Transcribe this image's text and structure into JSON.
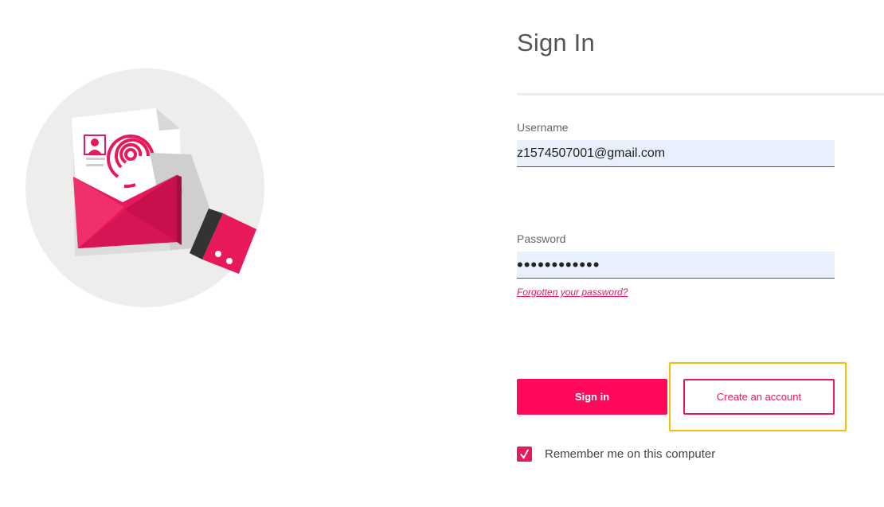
{
  "signin": {
    "title": "Sign In",
    "username": {
      "label": "Username",
      "value": "z1574507001@gmail.com"
    },
    "password": {
      "label": "Password",
      "value": "••••••••••••"
    },
    "forgot_link": "Forgotten your password?",
    "signin_button": "Sign in",
    "create_account_button": "Create an account",
    "remember_me": {
      "label": "Remember me on this computer",
      "checked": true
    }
  },
  "colors": {
    "accent": "#e8195a",
    "primary_button": "#ff0a5a",
    "input_bg": "#e8f0fe",
    "highlight": "#f5bd0b",
    "illustration_bg": "#ededec"
  },
  "illustration": {
    "icon": "fingerprint-envelope-illustration"
  }
}
